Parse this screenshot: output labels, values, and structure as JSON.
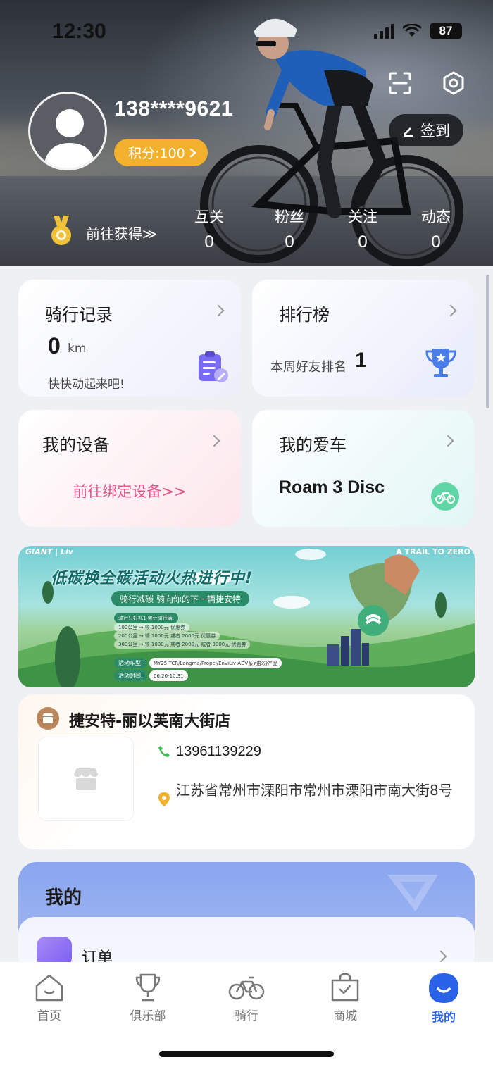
{
  "status_bar": {
    "time": "12:30",
    "battery": "87"
  },
  "profile": {
    "phone": "138****9621",
    "points_label": "积分:100",
    "signin_label": "签到",
    "goto_get": "前往获得≫"
  },
  "stats": [
    {
      "label": "互关",
      "value": "0"
    },
    {
      "label": "粉丝",
      "value": "0"
    },
    {
      "label": "关注",
      "value": "0"
    },
    {
      "label": "动态",
      "value": "0"
    }
  ],
  "cards": {
    "ride": {
      "title": "骑行记录",
      "value": "0",
      "unit": "km",
      "hint": "快快动起来吧!"
    },
    "rank": {
      "title": "排行榜",
      "label": "本周好友排名",
      "value": "1"
    },
    "device": {
      "title": "我的设备",
      "link": "前往绑定设备>>"
    },
    "bike": {
      "title": "我的爱车",
      "name": "Roam 3 Disc"
    }
  },
  "banner": {
    "brand": "GIANT | Liv",
    "trail": "A TRAIL TO ZERO",
    "title": "低碳换全碳活动火热进行中!",
    "subtitle": "骑行减碳 骑向你的下一辆捷安特",
    "gift_title": "骑行只好礼1 累计骑行满:",
    "lines": [
      "100公里 → 领 1000元 优惠券",
      "200公里 → 领 1000元 或者 2000元 优惠券",
      "300公里 → 领 1000元 或者 2000元 或者 3000元 优惠券"
    ],
    "models_label": "活动车型:",
    "models_value": "MY25 TCR/Langma/Propel/EnviLiv ADV系列部分产品",
    "time_label": "活动时间:",
    "time_value": "06.20-10.31"
  },
  "store": {
    "name": "捷安特-丽以芙南大街店",
    "phone": "13961139229",
    "address": "江苏省常州市溧阳市常州市溧阳市南大街8号"
  },
  "mine": {
    "title": "我的",
    "order_label": "订单"
  },
  "tabs": [
    {
      "label": "首页",
      "icon": "home-icon"
    },
    {
      "label": "俱乐部",
      "icon": "trophy-icon"
    },
    {
      "label": "骑行",
      "icon": "bike-icon"
    },
    {
      "label": "商城",
      "icon": "shopping-bag-icon"
    },
    {
      "label": "我的",
      "icon": "profile-icon"
    }
  ],
  "colors": {
    "accent": "#2a62e8",
    "points": "#f2b12c",
    "device_link": "#e5548a"
  }
}
